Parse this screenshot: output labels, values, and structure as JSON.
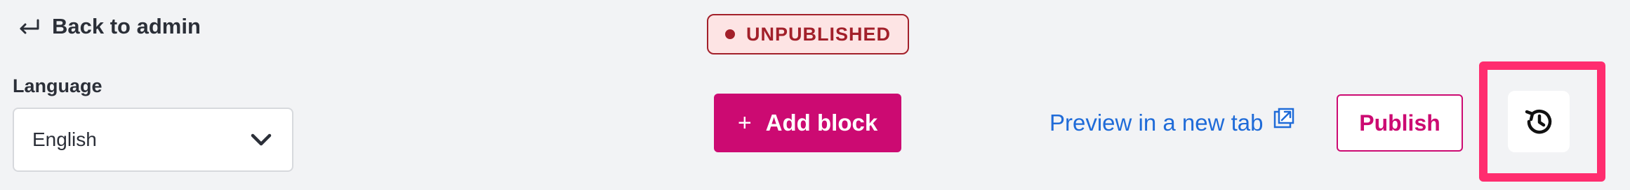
{
  "header": {
    "back_label": "Back to admin",
    "back_icon": "arrow-return-left-icon",
    "status_badge": "UNPUBLISHED"
  },
  "language": {
    "label": "Language",
    "selected": "English",
    "icon": "chevron-down-icon"
  },
  "toolbar": {
    "add_block_label": "Add block",
    "add_block_icon": "plus-icon",
    "preview_label": "Preview in a new tab",
    "preview_icon": "external-link-icon",
    "publish_label": "Publish",
    "history_icon": "history-icon"
  },
  "colors": {
    "accent": "#cc0a72",
    "link": "#1f6bd8",
    "status": "#a2202a",
    "highlight": "#ff2d6f",
    "background": "#f2f3f5"
  }
}
